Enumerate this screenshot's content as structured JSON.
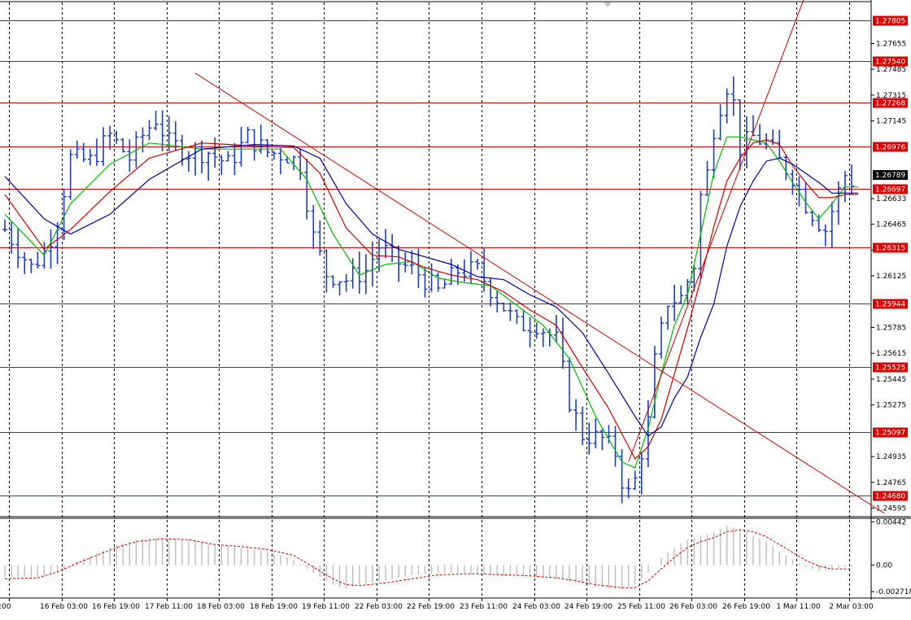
{
  "chart_data": [
    {
      "type": "candlestick",
      "title": "",
      "price_axis_ticks": [
        "1.27655",
        "1.27485",
        "1.27315",
        "1.27145",
        "1.26633",
        "1.26465",
        "1.26295",
        "1.26125",
        "1.25785",
        "1.25615",
        "1.25445",
        "1.25275",
        "1.24935",
        "1.24765",
        "1.24595"
      ],
      "ylim": [
        1.2455,
        1.2792
      ],
      "current_price": "1.26789",
      "current_price_value": 1.26789,
      "time_labels": [
        {
          "label": "1:00",
          "x": 0
        },
        {
          "label": "16 Feb 03:00",
          "x": 8
        },
        {
          "label": "16 Feb 19:00",
          "x": 16
        },
        {
          "label": "17 Feb 11:00",
          "x": 24
        },
        {
          "label": "18 Feb 03:00",
          "x": 32
        },
        {
          "label": "18 Feb 19:00",
          "x": 40
        },
        {
          "label": "19 Feb 11:00",
          "x": 48
        },
        {
          "label": "22 Feb 03:00",
          "x": 56
        },
        {
          "label": "22 Feb 19:00",
          "x": 64
        },
        {
          "label": "23 Feb 11:00",
          "x": 72
        },
        {
          "label": "24 Feb 03:00",
          "x": 80
        },
        {
          "label": "24 Feb 19:00",
          "x": 88
        },
        {
          "label": "25 Feb 11:00",
          "x": 96
        },
        {
          "label": "26 Feb 03:00",
          "x": 104
        },
        {
          "label": "26 Feb 19:00",
          "x": 112
        },
        {
          "label": "1 Mar 11:00",
          "x": 120
        },
        {
          "label": "2 Mar 03:00",
          "x": 128
        }
      ],
      "bar_count": 133,
      "support_resistance_levels": [
        {
          "label": "1.27805",
          "value": 1.27805
        },
        {
          "label": "1.27540",
          "value": 1.2754
        },
        {
          "label": "1.27268",
          "value": 1.27268
        },
        {
          "label": "1.26976",
          "value": 1.26976
        },
        {
          "label": "1.26697",
          "value": 1.26697
        },
        {
          "label": "1.26315",
          "value": 1.26315
        },
        {
          "label": "1.25944",
          "value": 1.25944
        },
        {
          "label": "1.25525",
          "value": 1.25525
        },
        {
          "label": "1.25097",
          "value": 1.25097
        },
        {
          "label": "1.24680",
          "value": 1.2468
        }
      ],
      "close_path": [
        [
          0,
          1.2643
        ],
        [
          4,
          1.2618
        ],
        [
          6,
          1.2628
        ],
        [
          8,
          1.2648
        ],
        [
          10,
          1.269
        ],
        [
          13,
          1.2688
        ],
        [
          16,
          1.2705
        ],
        [
          19,
          1.269
        ],
        [
          21,
          1.2705
        ],
        [
          23,
          1.2716
        ],
        [
          25,
          1.27
        ],
        [
          28,
          1.2694
        ],
        [
          31,
          1.2694
        ],
        [
          34,
          1.2686
        ],
        [
          37,
          1.2704
        ],
        [
          40,
          1.2694
        ],
        [
          43,
          1.2692
        ],
        [
          45,
          1.2686
        ],
        [
          47,
          1.2638
        ],
        [
          49,
          1.2614
        ],
        [
          52,
          1.261
        ],
        [
          55,
          1.2616
        ],
        [
          57,
          1.2632
        ],
        [
          60,
          1.2621
        ],
        [
          63,
          1.2614
        ],
        [
          66,
          1.2602
        ],
        [
          69,
          1.2616
        ],
        [
          72,
          1.2616
        ],
        [
          75,
          1.2598
        ],
        [
          78,
          1.258
        ],
        [
          81,
          1.2581
        ],
        [
          84,
          1.257
        ],
        [
          86,
          1.253
        ],
        [
          88,
          1.2508
        ],
        [
          91,
          1.2505
        ],
        [
          93,
          1.2496
        ],
        [
          94,
          1.2478
        ],
        [
          95,
          1.2469
        ],
        [
          96,
          1.2478
        ],
        [
          98,
          1.2516
        ],
        [
          99,
          1.2556
        ],
        [
          101,
          1.2596
        ],
        [
          103,
          1.2598
        ],
        [
          105,
          1.262
        ],
        [
          106,
          1.2665
        ],
        [
          107,
          1.268
        ],
        [
          108,
          1.271
        ],
        [
          109,
          1.2725
        ],
        [
          110,
          1.2738
        ],
        [
          111,
          1.2726
        ],
        [
          112,
          1.2697
        ],
        [
          114,
          1.2704
        ],
        [
          116,
          1.27
        ],
        [
          118,
          1.2688
        ],
        [
          120,
          1.2678
        ],
        [
          122,
          1.266
        ],
        [
          124,
          1.2648
        ],
        [
          125,
          1.2643
        ],
        [
          127,
          1.2668
        ],
        [
          128,
          1.2679
        ],
        [
          129,
          1.2675
        ]
      ],
      "moving_averages": [
        {
          "color": "#00bb00",
          "points": [
            [
              0,
              1.2653
            ],
            [
              6,
              1.2626
            ],
            [
              10,
              1.266
            ],
            [
              16,
              1.2686
            ],
            [
              22,
              1.27
            ],
            [
              30,
              1.2696
            ],
            [
              36,
              1.2696
            ],
            [
              42,
              1.2696
            ],
            [
              46,
              1.2676
            ],
            [
              50,
              1.264
            ],
            [
              54,
              1.2613
            ],
            [
              58,
              1.262
            ],
            [
              62,
              1.2622
            ],
            [
              66,
              1.2611
            ],
            [
              70,
              1.2608
            ],
            [
              74,
              1.2606
            ],
            [
              78,
              1.2593
            ],
            [
              82,
              1.258
            ],
            [
              86,
              1.2558
            ],
            [
              90,
              1.252
            ],
            [
              94,
              1.249
            ],
            [
              96,
              1.2486
            ],
            [
              98,
              1.2512
            ],
            [
              100,
              1.2548
            ],
            [
              102,
              1.258
            ],
            [
              104,
              1.26
            ],
            [
              106,
              1.264
            ],
            [
              108,
              1.268
            ],
            [
              110,
              1.2704
            ],
            [
              112,
              1.2704
            ],
            [
              114,
              1.2702
            ],
            [
              116,
              1.27
            ],
            [
              118,
              1.2688
            ],
            [
              120,
              1.2674
            ],
            [
              122,
              1.2661
            ],
            [
              124,
              1.265
            ],
            [
              126,
              1.266
            ],
            [
              128,
              1.2671
            ],
            [
              130,
              1.2671
            ]
          ]
        },
        {
          "color": "#d00000",
          "points": [
            [
              0,
              1.2666
            ],
            [
              6,
              1.263
            ],
            [
              10,
              1.2643
            ],
            [
              16,
              1.2668
            ],
            [
              22,
              1.269
            ],
            [
              30,
              1.27
            ],
            [
              38,
              1.2698
            ],
            [
              44,
              1.2697
            ],
            [
              48,
              1.268
            ],
            [
              52,
              1.2644
            ],
            [
              56,
              1.2626
            ],
            [
              60,
              1.2625
            ],
            [
              64,
              1.2618
            ],
            [
              68,
              1.2613
            ],
            [
              72,
              1.261
            ],
            [
              76,
              1.2602
            ],
            [
              80,
              1.259
            ],
            [
              84,
              1.258
            ],
            [
              88,
              1.2552
            ],
            [
              92,
              1.2525
            ],
            [
              96,
              1.2492
            ],
            [
              98,
              1.25
            ],
            [
              100,
              1.2518
            ],
            [
              102,
              1.2548
            ],
            [
              104,
              1.2578
            ],
            [
              106,
              1.261
            ],
            [
              108,
              1.2645
            ],
            [
              110,
              1.2675
            ],
            [
              112,
              1.269
            ],
            [
              114,
              1.27
            ],
            [
              116,
              1.2702
            ],
            [
              118,
              1.2699
            ],
            [
              120,
              1.2685
            ],
            [
              122,
              1.2674
            ],
            [
              124,
              1.2664
            ],
            [
              126,
              1.2664
            ],
            [
              128,
              1.2666
            ],
            [
              130,
              1.2666
            ]
          ]
        },
        {
          "color": "#0000aa",
          "points": [
            [
              0,
              1.2678
            ],
            [
              6,
              1.265
            ],
            [
              10,
              1.264
            ],
            [
              16,
              1.2653
            ],
            [
              22,
              1.2676
            ],
            [
              30,
              1.2696
            ],
            [
              38,
              1.2699
            ],
            [
              44,
              1.2698
            ],
            [
              48,
              1.269
            ],
            [
              52,
              1.266
            ],
            [
              56,
              1.264
            ],
            [
              60,
              1.263
            ],
            [
              64,
              1.2625
            ],
            [
              68,
              1.262
            ],
            [
              72,
              1.2612
            ],
            [
              76,
              1.261
            ],
            [
              80,
              1.26
            ],
            [
              84,
              1.2592
            ],
            [
              88,
              1.2575
            ],
            [
              92,
              1.2548
            ],
            [
              96,
              1.252
            ],
            [
              98,
              1.2507
            ],
            [
              100,
              1.2513
            ],
            [
              102,
              1.2532
            ],
            [
              104,
              1.2546
            ],
            [
              106,
              1.2572
            ],
            [
              108,
              1.2594
            ],
            [
              110,
              1.2632
            ],
            [
              112,
              1.2658
            ],
            [
              114,
              1.2675
            ],
            [
              116,
              1.2688
            ],
            [
              118,
              1.269
            ],
            [
              120,
              1.2686
            ],
            [
              122,
              1.268
            ],
            [
              124,
              1.2674
            ],
            [
              126,
              1.2667
            ],
            [
              128,
              1.2667
            ],
            [
              130,
              1.2667
            ]
          ]
        }
      ],
      "trend_lines": [
        {
          "name": "descending-trend-line",
          "color": "#cc0000",
          "from": [
            29,
            1.2746
          ],
          "to": [
            134,
            1.2456
          ]
        },
        {
          "name": "ascending-trend-line",
          "color": "#cc0000",
          "from": [
            95,
            1.249
          ],
          "to": [
            122,
            1.2798
          ]
        }
      ]
    },
    {
      "type": "macd-histogram",
      "ticks": [
        "0.00442",
        "0.00",
        "-0.002718"
      ],
      "ylim": [
        -0.0032,
        0.0047
      ],
      "histogram": [
        [
          0,
          -0.0012
        ],
        [
          5,
          -0.0012
        ],
        [
          8,
          -0.0008
        ],
        [
          11,
          0.0004
        ],
        [
          14,
          0.0012
        ],
        [
          17,
          0.002
        ],
        [
          20,
          0.0026
        ],
        [
          24,
          0.0028
        ],
        [
          28,
          0.0026
        ],
        [
          32,
          0.002
        ],
        [
          36,
          0.0018
        ],
        [
          40,
          0.0014
        ],
        [
          44,
          0.0006
        ],
        [
          46,
          -0.0004
        ],
        [
          48,
          -0.0012
        ],
        [
          50,
          -0.002
        ],
        [
          52,
          -0.0024
        ],
        [
          54,
          -0.002
        ],
        [
          58,
          -0.0016
        ],
        [
          62,
          -0.001
        ],
        [
          66,
          -0.0008
        ],
        [
          70,
          -0.0008
        ],
        [
          72,
          -0.001
        ],
        [
          76,
          -0.001
        ],
        [
          80,
          -0.0012
        ],
        [
          84,
          -0.0014
        ],
        [
          87,
          -0.0018
        ],
        [
          90,
          -0.0022
        ],
        [
          94,
          -0.0025
        ],
        [
          96,
          -0.002
        ],
        [
          98,
          -0.0008
        ],
        [
          100,
          0.0008
        ],
        [
          102,
          0.0018
        ],
        [
          104,
          0.0026
        ],
        [
          106,
          0.003
        ],
        [
          108,
          0.0034
        ],
        [
          110,
          0.004
        ],
        [
          112,
          0.0037
        ],
        [
          114,
          0.003
        ],
        [
          116,
          0.0024
        ],
        [
          118,
          0.0014
        ],
        [
          120,
          0.0006
        ],
        [
          122,
          -0.0002
        ],
        [
          124,
          -0.0006
        ],
        [
          126,
          -0.0004
        ],
        [
          128,
          -0.0002
        ],
        [
          129,
          -0.0002
        ]
      ],
      "signal": [
        [
          0,
          -0.0014
        ],
        [
          5,
          -0.0013
        ],
        [
          8,
          -0.0007
        ],
        [
          11,
          0.0002
        ],
        [
          14,
          0.001
        ],
        [
          17,
          0.0018
        ],
        [
          20,
          0.0024
        ],
        [
          24,
          0.0027
        ],
        [
          28,
          0.0026
        ],
        [
          32,
          0.0021
        ],
        [
          36,
          0.0019
        ],
        [
          40,
          0.0016
        ],
        [
          44,
          0.001
        ],
        [
          46,
          0.0002
        ],
        [
          48,
          -0.0006
        ],
        [
          50,
          -0.0014
        ],
        [
          52,
          -0.002
        ],
        [
          54,
          -0.0021
        ],
        [
          58,
          -0.0018
        ],
        [
          62,
          -0.0014
        ],
        [
          66,
          -0.001
        ],
        [
          70,
          -0.0009
        ],
        [
          72,
          -0.0009
        ],
        [
          76,
          -0.001
        ],
        [
          80,
          -0.0011
        ],
        [
          84,
          -0.0013
        ],
        [
          87,
          -0.0016
        ],
        [
          90,
          -0.002
        ],
        [
          94,
          -0.0023
        ],
        [
          96,
          -0.0023
        ],
        [
          98,
          -0.0016
        ],
        [
          100,
          -0.0004
        ],
        [
          102,
          0.0008
        ],
        [
          104,
          0.0018
        ],
        [
          106,
          0.0024
        ],
        [
          108,
          0.0028
        ],
        [
          110,
          0.0034
        ],
        [
          112,
          0.0036
        ],
        [
          114,
          0.0034
        ],
        [
          116,
          0.0029
        ],
        [
          118,
          0.0021
        ],
        [
          120,
          0.0013
        ],
        [
          122,
          0.0005
        ],
        [
          124,
          -0.0001
        ],
        [
          126,
          -0.0004
        ],
        [
          128,
          -0.0004
        ],
        [
          129,
          -0.0004
        ]
      ]
    }
  ],
  "colors": {
    "bar": "#1f3fbf",
    "level": "#dd0000",
    "badge": "#dd0000",
    "current_badge": "#000000",
    "grid": "#000000",
    "histogram": "#bdbdbd",
    "signal": "#dd0000"
  }
}
